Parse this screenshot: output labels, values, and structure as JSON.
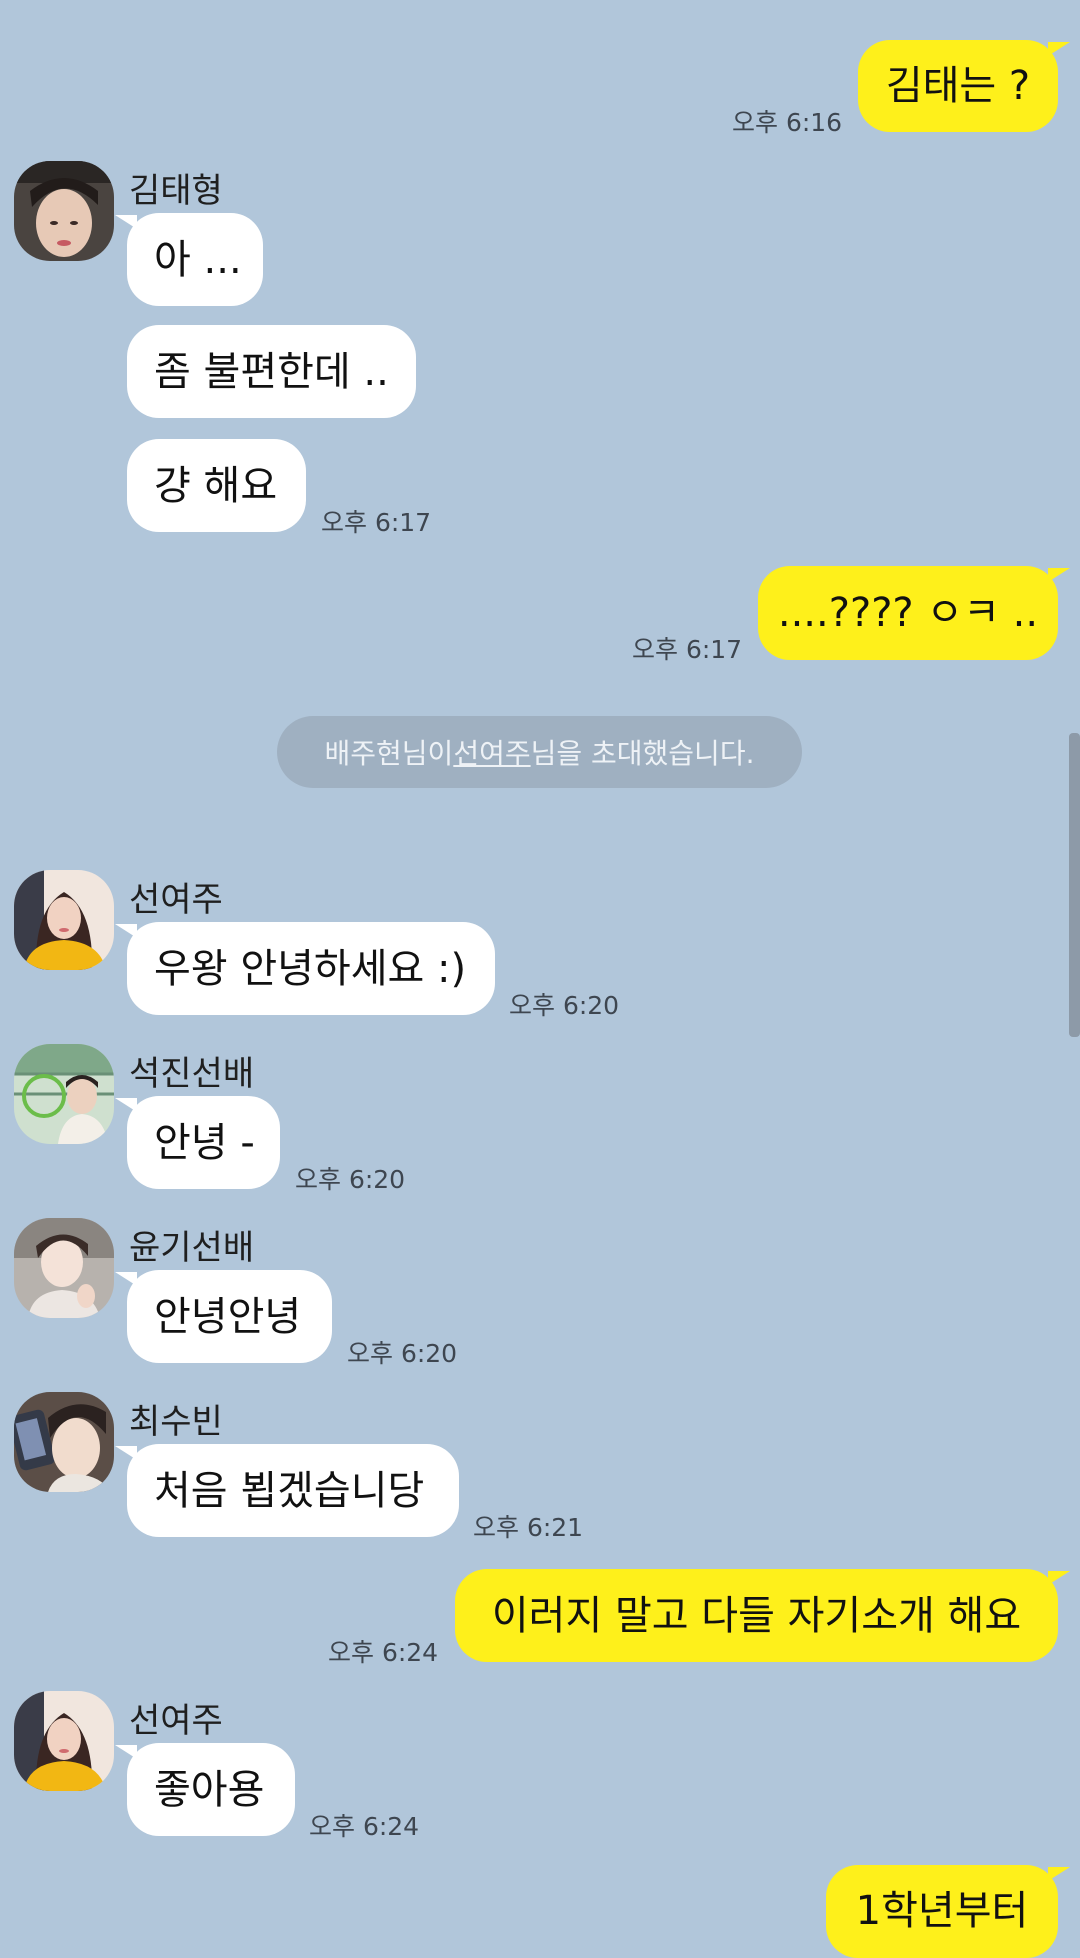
{
  "messages": [
    {
      "type": "out",
      "text": "김태는 ?",
      "time": "오후 6:16"
    },
    {
      "type": "in",
      "sender": "김태형",
      "avatar": "avatar-taehyung",
      "bubbles": [
        {
          "text": "아 ..."
        },
        {
          "text": "좀 불편한데 .."
        },
        {
          "text": "걍 해요",
          "time": "오후 6:17"
        }
      ]
    },
    {
      "type": "out",
      "text": "....???? ㅇㅋ ..",
      "time": "오후 6:17"
    },
    {
      "type": "system",
      "parts": [
        {
          "text": "배주현님이 "
        },
        {
          "text": "선여주",
          "underline": true
        },
        {
          "text": "님을 초대했습니다."
        }
      ]
    },
    {
      "type": "in",
      "sender": "선여주",
      "avatar": "avatar-yeoju",
      "bubbles": [
        {
          "text": "우왕 안녕하세요 :)",
          "time": "오후 6:20"
        }
      ]
    },
    {
      "type": "in",
      "sender": "석진선배",
      "avatar": "avatar-seokjin",
      "bubbles": [
        {
          "text": "안녕 -",
          "time": "오후 6:20"
        }
      ]
    },
    {
      "type": "in",
      "sender": "윤기선배",
      "avatar": "avatar-yoongi",
      "bubbles": [
        {
          "text": "안녕안녕",
          "time": "오후 6:20"
        }
      ]
    },
    {
      "type": "in",
      "sender": "최수빈",
      "avatar": "avatar-soobin",
      "bubbles": [
        {
          "text": "처음 뵙겠습니당",
          "time": "오후 6:21"
        }
      ]
    },
    {
      "type": "out",
      "text": "이러지 말고 다들 자기소개 해요",
      "time": "오후 6:24"
    },
    {
      "type": "in",
      "sender": "선여주",
      "avatar": "avatar-yeoju",
      "bubbles": [
        {
          "text": "좋아용",
          "time": "오후 6:24"
        }
      ]
    },
    {
      "type": "out",
      "text": "1학년부터"
    }
  ],
  "colors": {
    "background": "#b1c6da",
    "bubble_in": "#ffffff",
    "bubble_out": "#fef01b",
    "system_bg": "#9fb0c1"
  }
}
